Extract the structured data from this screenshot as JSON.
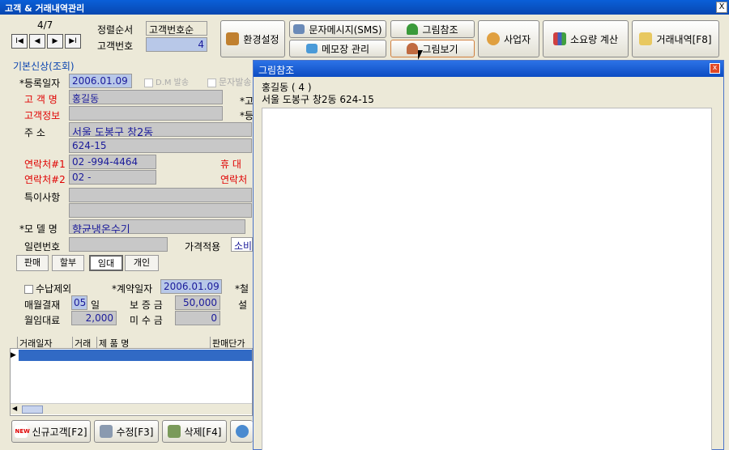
{
  "window": {
    "title": "고객 & 거래내역관리",
    "close": "X"
  },
  "nav": {
    "record": "4/7",
    "first": "I◀",
    "prev": "◀",
    "next": "▶",
    "last": "▶I"
  },
  "sort": {
    "label": "정렬순서",
    "value": "고객번호순",
    "number_label": "고객번호",
    "number_value": "4"
  },
  "toolbar": {
    "env": "환경설정",
    "sms": "문자메시지(SMS)",
    "memo": "메모장 관리",
    "pic_ref": "그림참조",
    "pic_view": "그림보기",
    "business": "사업자",
    "consumption": "소요량 계산",
    "trade": "거래내역[F8]"
  },
  "section": {
    "title": "기본신상(조회)"
  },
  "form": {
    "reg_date_label": "*등록일자",
    "reg_date": "2006.01.09",
    "dm_label": "D.M 발송",
    "sms_send_label": "문자발송",
    "name_label": "고 객 명",
    "name": "홍길동",
    "info_label": "고객정보",
    "addr_label": "주     소",
    "addr1": "서울 도봉구 창2동",
    "addr2": "624-15",
    "tel1_label": "연락처#1",
    "tel1": "02  -994-4464",
    "mobile_label": "휴 대",
    "tel2_label": "연락처#2",
    "tel2": "02  -",
    "tel3_label": "연락처",
    "special_label": "특이사항",
    "model_label": "*모 델 명",
    "model": "향균냉온수기",
    "serial_label": "일련번호",
    "price_label": "가격적용",
    "price_value": "소비",
    "right_cut1": "*고",
    "right_cut2": "*등"
  },
  "modes": [
    "판매",
    "할부",
    "임대",
    "개인"
  ],
  "contract": {
    "exclude_label": "수납제외",
    "contract_date_label": "*계약일자",
    "contract_date": "2006.01.09",
    "right_cut": "*철",
    "monthly_label": "매월결재",
    "monthly_value": "05",
    "monthly_unit": "일",
    "deposit_label": "보 증 금",
    "deposit": "50,000",
    "right_cut2": "설",
    "rent_label": "월임대료",
    "rent": "2,000",
    "unpaid_label": "미 수 금",
    "unpaid": "0"
  },
  "grid": {
    "columns": [
      "거래일자",
      "거래",
      "제  품  명",
      "판매단가"
    ]
  },
  "bottom": {
    "new": "신규고객[F2]",
    "edit": "수정[F3]",
    "delete": "삭제[F4]",
    "new_badge": "NEW"
  },
  "popup": {
    "title": "그림참조",
    "close": "x",
    "line1": "홍길동 ( 4 )",
    "line2": "서울 도봉구 창2동 624-15"
  },
  "colors": {
    "titlebar": "#0a5fd8",
    "field_blue": "#b8c8e8",
    "label_red": "#e00000",
    "grid_select": "#316ac5"
  }
}
